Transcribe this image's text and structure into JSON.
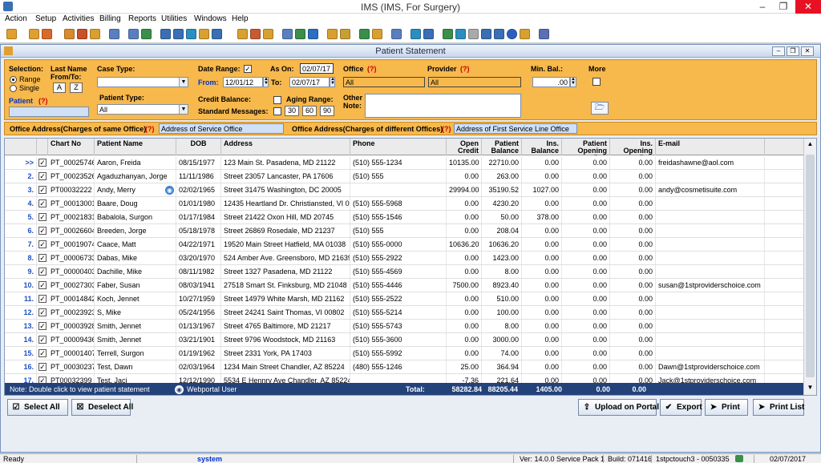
{
  "app": {
    "title": "IMS (IMS, For Surgery)"
  },
  "menu": [
    "Action",
    "Setup",
    "Activities",
    "Billing",
    "Reports",
    "Utilities",
    "Windows",
    "Help"
  ],
  "window": {
    "title": "Patient Statement"
  },
  "filters": {
    "selection_label": "Selection:",
    "range_label": "Range",
    "single_label": "Single",
    "lastname_label": "Last Name From/To:",
    "from_letter": "A",
    "to_letter": "Z",
    "patient_label": "Patient",
    "help_mark": "(?)",
    "case_type_label": "Case Type:",
    "case_type_value": "",
    "patient_type_label": "Patient Type:",
    "patient_type_value": "All",
    "date_range_label": "Date Range:",
    "from_label": "From:",
    "from_date": "12/01/12",
    "to_label": "To:",
    "to_date": "02/07/17",
    "as_on_label": "As On:",
    "as_on_date": "02/07/17",
    "credit_balance_label": "Credit Balance:",
    "aging_range_label": "Aging Range:",
    "standard_messages_label": "Standard Messages:",
    "aging": [
      "30",
      "60",
      "90"
    ],
    "office_label": "Office",
    "office_value": "All",
    "provider_label": "Provider",
    "provider_value": "All",
    "other_note_label": "Other Note:",
    "min_bal_label": "Min. Bal.:",
    "min_bal_value": ".00",
    "more_label": "More"
  },
  "address": {
    "same_label": "Office Address(Charges of same Office)",
    "same_value": "Address of Service Office",
    "diff_label": "Office Address(Charges of different Offices)",
    "diff_value": "Address of First Service Line Office"
  },
  "columns": [
    "Chart No",
    "Patient Name",
    "DOB",
    "Address",
    "Phone",
    "Open Credit",
    "Patient Balance",
    "Ins. Balance",
    "Patient Opening Bal.",
    "Ins. Opening Bal.",
    "E-mail"
  ],
  "rows": [
    {
      "n": ">>",
      "chart": "PT_00025746",
      "name": "Aaron, Freida",
      "dob": "08/15/1977",
      "addr": "123 Main St. Pasadena, MD 21122",
      "phone": "(510) 555-1234",
      "credit": "10135.00",
      "pbal": "22710.00",
      "ibal": "0.00",
      "popen": "0.00",
      "iopen": "0.00",
      "email": "freidashawne@aol.com"
    },
    {
      "n": "2.",
      "chart": "PT_00023526",
      "name": "Agaduzhanyan, Jorge",
      "dob": "11/11/1986",
      "addr": "Street 23057 Lancaster, PA 17606",
      "phone": "(510) 555",
      "credit": "0.00",
      "pbal": "263.00",
      "ibal": "0.00",
      "popen": "0.00",
      "iopen": "0.00",
      "email": ""
    },
    {
      "n": "3.",
      "chart": "PT00032222",
      "name": "Andy, Merry",
      "dob": "02/02/1965",
      "addr": "Street 31475 Washington, DC 20005",
      "phone": "",
      "credit": "29994.00",
      "pbal": "35190.52",
      "ibal": "1027.00",
      "popen": "0.00",
      "iopen": "0.00",
      "email": "andy@cosmetisuite.com"
    },
    {
      "n": "4.",
      "chart": "PT_00013001",
      "name": "Baare, Doug",
      "dob": "01/01/1980",
      "addr": "12435 Heartland Dr. Christiansted, VI 00820",
      "phone": "(510) 555-5968",
      "credit": "0.00",
      "pbal": "4230.20",
      "ibal": "0.00",
      "popen": "0.00",
      "iopen": "0.00",
      "email": ""
    },
    {
      "n": "5.",
      "chart": "PT_00021831",
      "name": "Babalola, Surgon",
      "dob": "01/17/1984",
      "addr": "Street 21422 Oxon Hill, MD 20745",
      "phone": "(510) 555-1546",
      "credit": "0.00",
      "pbal": "50.00",
      "ibal": "378.00",
      "popen": "0.00",
      "iopen": "0.00",
      "email": ""
    },
    {
      "n": "6.",
      "chart": "PT_00026604",
      "name": "Breeden, Jorge",
      "dob": "05/18/1978",
      "addr": "Street 26869 Rosedale, MD 21237",
      "phone": "(510) 555",
      "credit": "0.00",
      "pbal": "208.04",
      "ibal": "0.00",
      "popen": "0.00",
      "iopen": "0.00",
      "email": ""
    },
    {
      "n": "7.",
      "chart": "PT_00019074",
      "name": "Caace, Matt",
      "dob": "04/22/1971",
      "addr": "19520 Main Street Hatfield, MA 01038",
      "phone": "(510) 555-0000",
      "credit": "10636.20",
      "pbal": "10636.20",
      "ibal": "0.00",
      "popen": "0.00",
      "iopen": "0.00",
      "email": ""
    },
    {
      "n": "8.",
      "chart": "PT_00006733",
      "name": "Dabas, Mike",
      "dob": "03/20/1970",
      "addr": "524 Amber Ave. Greensboro, MD 21639",
      "phone": "(510) 555-2922",
      "credit": "0.00",
      "pbal": "1423.00",
      "ibal": "0.00",
      "popen": "0.00",
      "iopen": "0.00",
      "email": ""
    },
    {
      "n": "9.",
      "chart": "PT_00000403",
      "name": "Dachille, Mike",
      "dob": "08/11/1982",
      "addr": "Street 1327 Pasadena, MD 21122",
      "phone": "(510) 555-4569",
      "credit": "0.00",
      "pbal": "8.00",
      "ibal": "0.00",
      "popen": "0.00",
      "iopen": "0.00",
      "email": ""
    },
    {
      "n": "10.",
      "chart": "PT_00027303",
      "name": "Faber, Susan",
      "dob": "08/03/1941",
      "addr": "27518 Smart St. Finksburg, MD 21048",
      "phone": "(510) 555-4446",
      "credit": "7500.00",
      "pbal": "8923.40",
      "ibal": "0.00",
      "popen": "0.00",
      "iopen": "0.00",
      "email": "susan@1stproviderschoice.com"
    },
    {
      "n": "11.",
      "chart": "PT_00014842",
      "name": "Koch, Jennet",
      "dob": "10/27/1959",
      "addr": "Street 14979 White Marsh, MD 21162",
      "phone": "(510) 555-2522",
      "credit": "0.00",
      "pbal": "510.00",
      "ibal": "0.00",
      "popen": "0.00",
      "iopen": "0.00",
      "email": ""
    },
    {
      "n": "12.",
      "chart": "PT_00023923",
      "name": "S, Mike",
      "dob": "05/24/1956",
      "addr": "Street 24241 Saint Thomas, VI 00802",
      "phone": "(510) 555-5214",
      "credit": "0.00",
      "pbal": "100.00",
      "ibal": "0.00",
      "popen": "0.00",
      "iopen": "0.00",
      "email": ""
    },
    {
      "n": "13.",
      "chart": "PT_00003928",
      "name": "Smith, Jennet",
      "dob": "01/13/1967",
      "addr": "Street 4765 Baltimore, MD 21217",
      "phone": "(510) 555-5743",
      "credit": "0.00",
      "pbal": "8.00",
      "ibal": "0.00",
      "popen": "0.00",
      "iopen": "0.00",
      "email": ""
    },
    {
      "n": "14.",
      "chart": "PT_00009436",
      "name": "Smith, Jennet",
      "dob": "03/21/1901",
      "addr": "Street 9796 Woodstock, MD 21163",
      "phone": "(510) 555-3600",
      "credit": "0.00",
      "pbal": "3000.00",
      "ibal": "0.00",
      "popen": "0.00",
      "iopen": "0.00",
      "email": ""
    },
    {
      "n": "15.",
      "chart": "PT_00001407",
      "name": "Terrell, Surgon",
      "dob": "01/19/1962",
      "addr": "Street 2331 York, PA 17403",
      "phone": "(510) 555-5992",
      "credit": "0.00",
      "pbal": "74.00",
      "ibal": "0.00",
      "popen": "0.00",
      "iopen": "0.00",
      "email": ""
    },
    {
      "n": "16.",
      "chart": "PT_00030237",
      "name": "Test, Dawn",
      "dob": "02/03/1964",
      "addr": "1234 Main Street Chandler, AZ 85224",
      "phone": "(480) 555-1246",
      "credit": "25.00",
      "pbal": "364.94",
      "ibal": "0.00",
      "popen": "0.00",
      "iopen": "0.00",
      "email": "Dawn@1stproviderschoice.com"
    },
    {
      "n": "17.",
      "chart": "PT00032399",
      "name": "Test, Jacj",
      "dob": "12/12/1990",
      "addr": "5534 E Hennry Ave Chandler, AZ 85224",
      "phone": "",
      "credit": "-7.36",
      "pbal": "221.64",
      "ibal": "0.00",
      "popen": "0.00",
      "iopen": "0.00",
      "email": "Jack@1stproviderschoice.com"
    }
  ],
  "footer": {
    "note": "Note: Double click to view patient statement",
    "webportal": "Webportal User",
    "total_label": "Total:",
    "totals": [
      "58282.84",
      "88205.44",
      "1405.00",
      "0.00",
      "0.00"
    ]
  },
  "buttons": {
    "select_all": "Select All",
    "deselect_all": "Deselect All",
    "upload": "Upload on Portal",
    "export": "Export",
    "print": "Print",
    "print_list": "Print List"
  },
  "status": {
    "ready": "Ready",
    "user": "system",
    "version": "Ver: 14.0.0 Service Pack 1",
    "build": "Build: 071416",
    "server": "1stpctouch3 - 0050335",
    "date": "02/07/2017"
  },
  "colors": {
    "accent_orange": "#f7b84c",
    "total_bar": "#23427a",
    "row_number": "#1e50c0"
  }
}
